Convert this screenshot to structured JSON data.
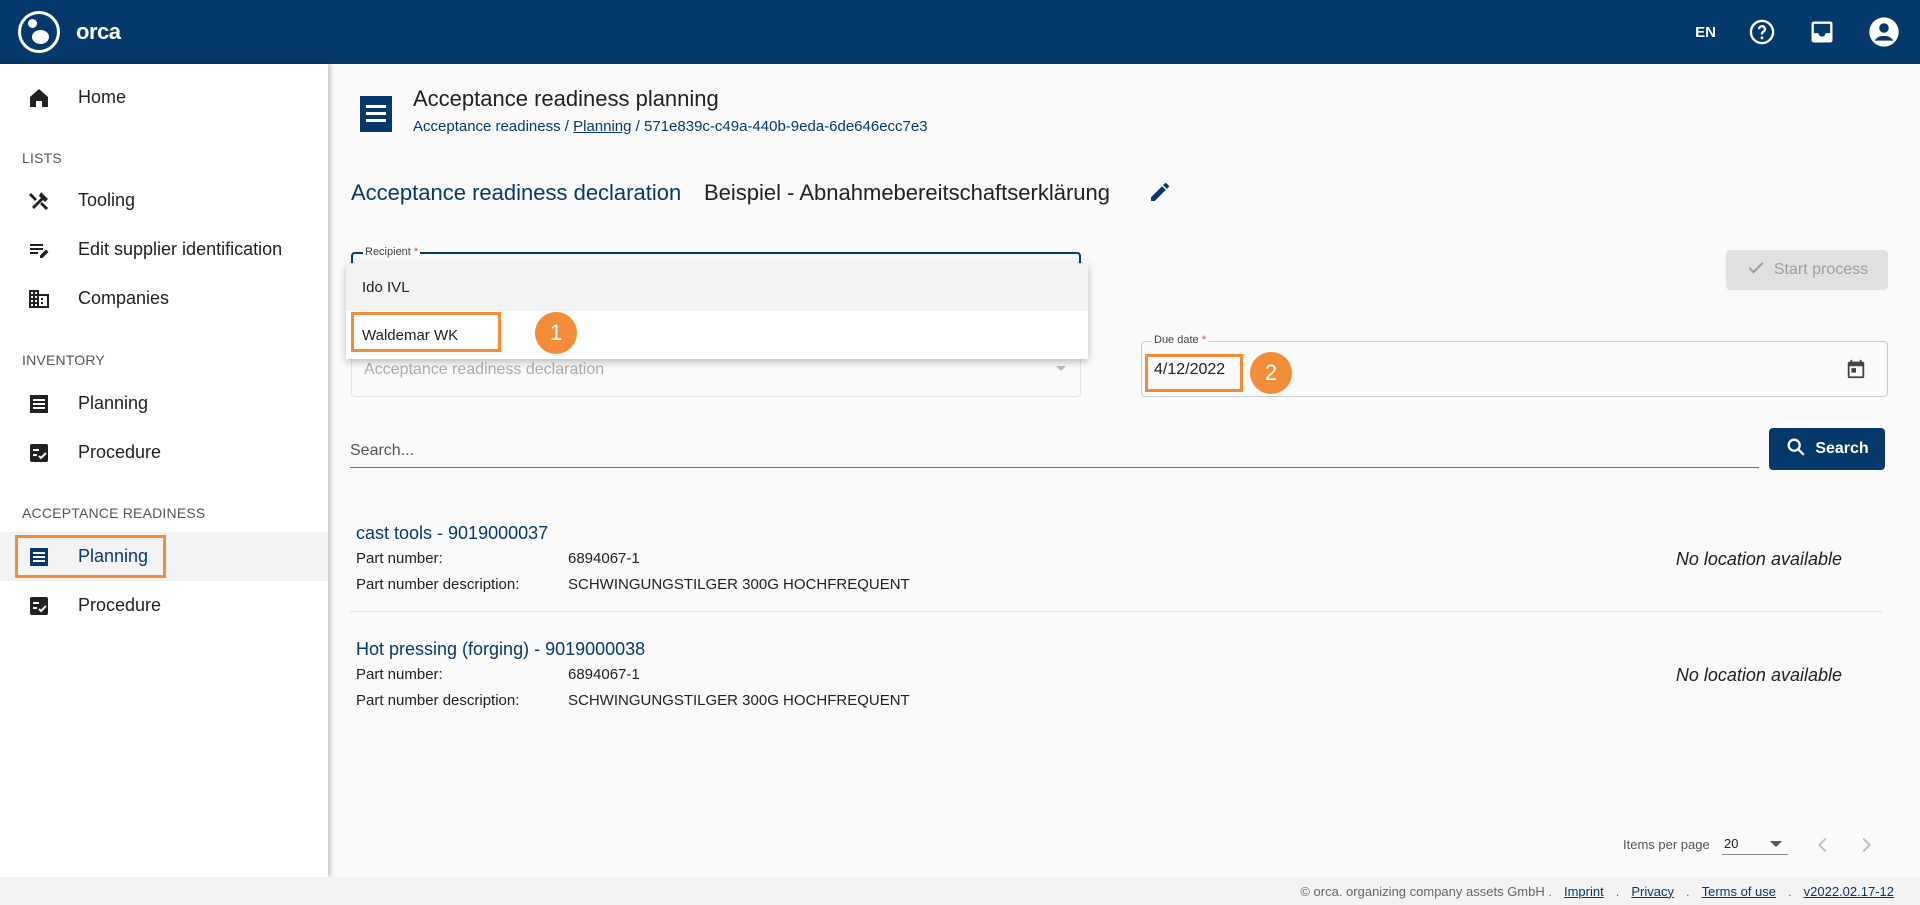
{
  "app": {
    "brand": "orca",
    "lang": "EN"
  },
  "sidebar": {
    "home": "Home",
    "sections": {
      "lists": "LISTS",
      "inventory": "INVENTORY",
      "acceptance": "ACCEPTANCE READINESS"
    },
    "items": {
      "tooling": "Tooling",
      "edit_supplier": "Edit supplier identification",
      "companies": "Companies",
      "inv_planning": "Planning",
      "inv_procedure": "Procedure",
      "acc_planning": "Planning",
      "acc_procedure": "Procedure"
    }
  },
  "header": {
    "title": "Acceptance readiness planning",
    "breadcrumb": {
      "root": "Acceptance readiness",
      "sep1": "/",
      "planning": "Planning",
      "sep2": "/",
      "id": "571e839c-c49a-440b-9eda-6de646ecc7e3"
    }
  },
  "declaration": {
    "label": "Acceptance readiness declaration",
    "name": "Beispiel - Abnahmebereitschaftserklärung"
  },
  "form": {
    "recipient_label": "Recipient",
    "required_mark": "*",
    "recipient_options": [
      "Ido IVL",
      "Waldemar WK"
    ],
    "type_placeholder": "Acceptance readiness declaration",
    "due_label": "Due date",
    "due_value": "4/12/2022",
    "start_label": "Start process"
  },
  "annotations": {
    "one": "1",
    "two": "2"
  },
  "search": {
    "placeholder": "Search...",
    "button": "Search"
  },
  "results": [
    {
      "title": "cast tools - 9019000037",
      "part_number_label": "Part number:",
      "part_number": "6894067-1",
      "desc_label": "Part number description:",
      "desc": "SCHWINGUNGSTILGER 300G HOCHFREQUENT",
      "location": "No location available"
    },
    {
      "title": "Hot pressing (forging) - 9019000038",
      "part_number_label": "Part number:",
      "part_number": "6894067-1",
      "desc_label": "Part number description:",
      "desc": "SCHWINGUNGSTILGER 300G HOCHFREQUENT",
      "location": "No location available"
    }
  ],
  "pager": {
    "label": "Items per page",
    "value": "20"
  },
  "footer": {
    "copy": "© orca. organizing company assets GmbH .",
    "imprint": "Imprint",
    "privacy": "Privacy",
    "terms": "Terms of use",
    "version": "v2022.02.17-12",
    "dot": "."
  },
  "colors": {
    "primary": "#06396b",
    "highlight": "#f28c38"
  }
}
